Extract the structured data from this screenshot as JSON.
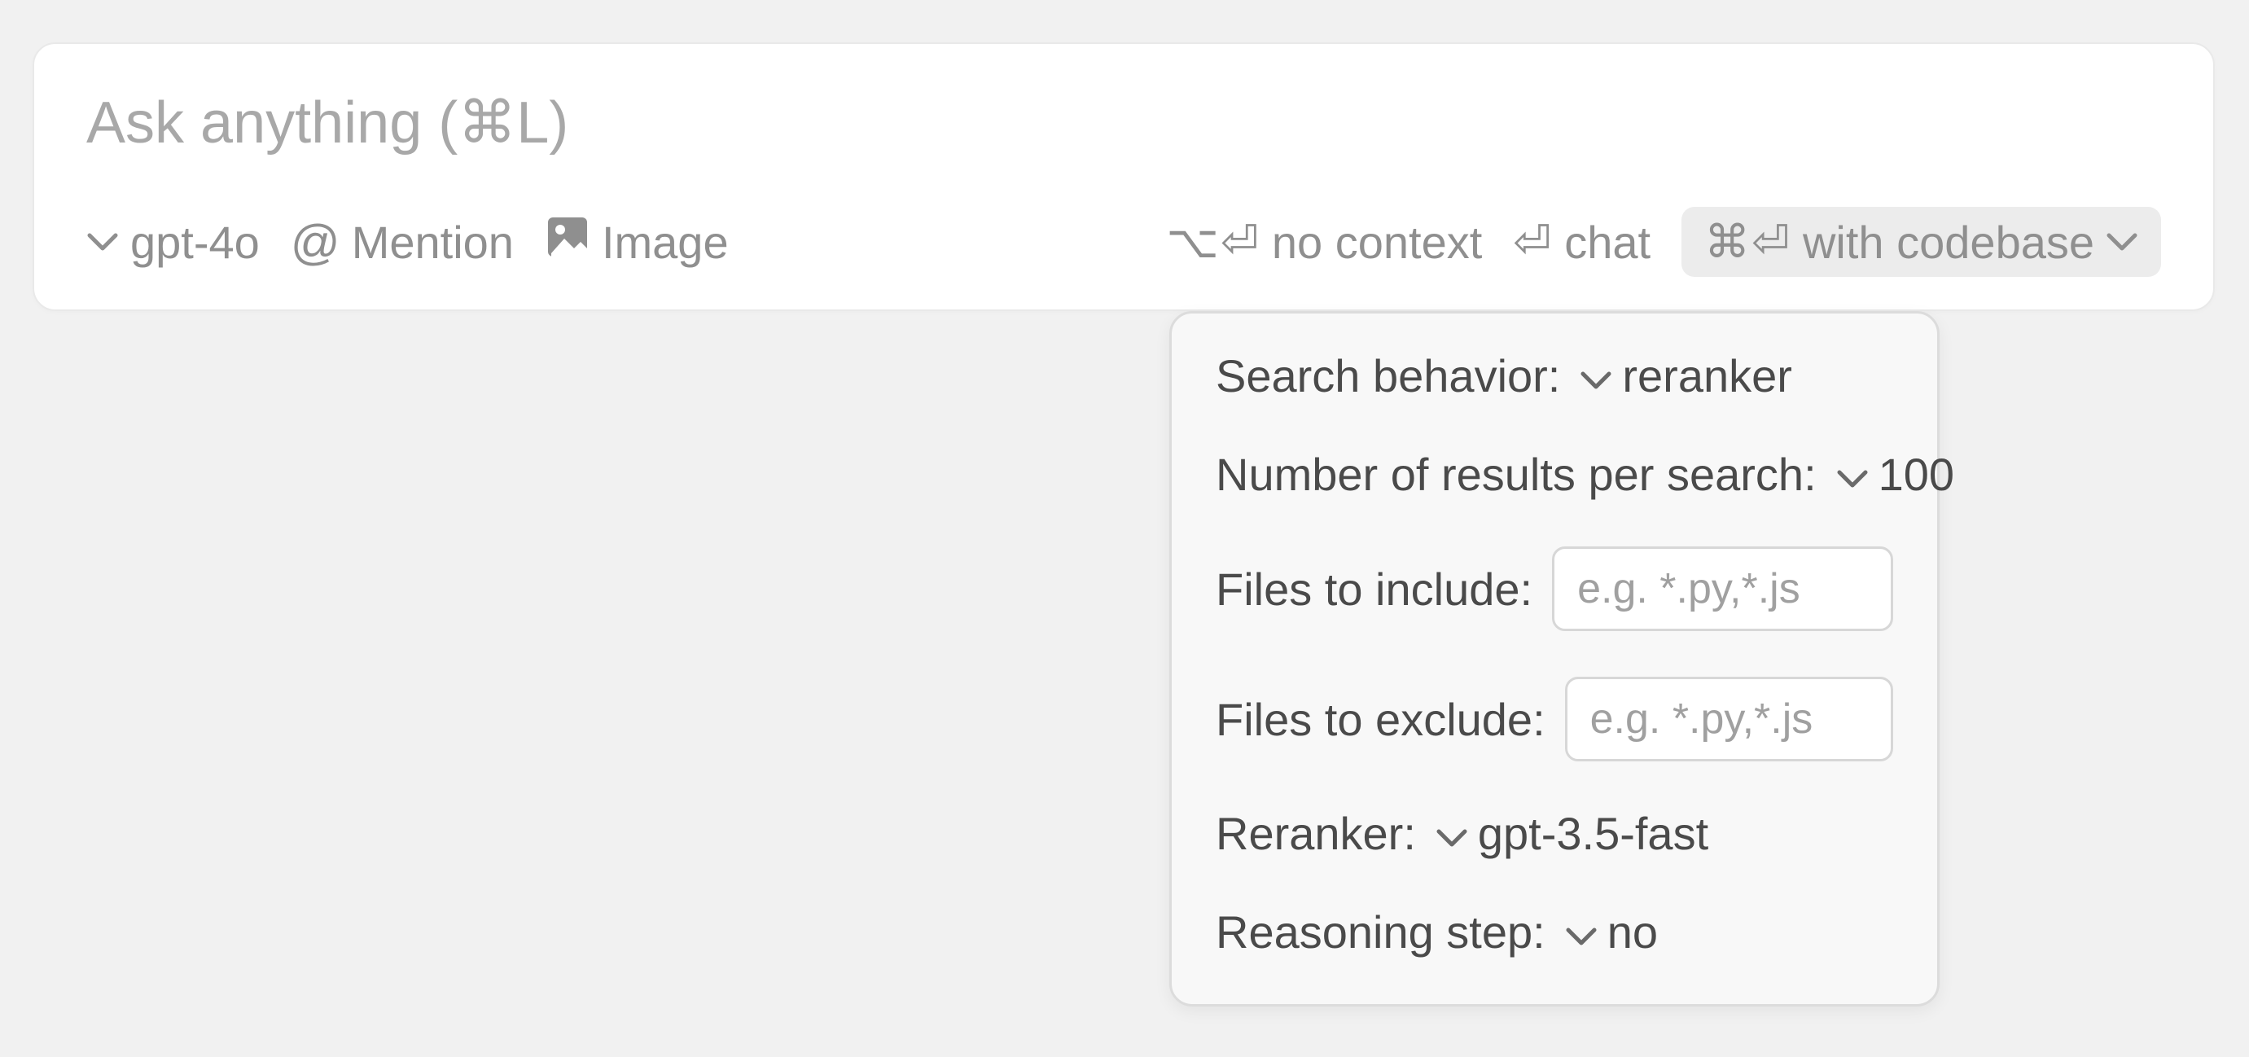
{
  "prompt": {
    "placeholder": "Ask anything (⌘L)",
    "value": ""
  },
  "toolbar": {
    "model": "gpt-4o",
    "mention": "Mention",
    "mention_prefix": "@",
    "image": "Image",
    "no_context": {
      "kbd": "⌥⏎",
      "label": "no context"
    },
    "chat": {
      "kbd": "⏎",
      "label": "chat"
    },
    "with_codebase": {
      "kbd": "⌘⏎",
      "label": "with codebase"
    }
  },
  "settings": {
    "search_behavior": {
      "label": "Search behavior:",
      "value": "reranker"
    },
    "results_per_search": {
      "label": "Number of results per search:",
      "value": "100"
    },
    "files_include": {
      "label": "Files to include:",
      "placeholder": "e.g. *.py,*.js",
      "value": ""
    },
    "files_exclude": {
      "label": "Files to exclude:",
      "placeholder": "e.g. *.py,*.js",
      "value": ""
    },
    "reranker": {
      "label": "Reranker:",
      "value": "gpt-3.5-fast"
    },
    "reasoning_step": {
      "label": "Reasoning step:",
      "value": "no"
    }
  }
}
